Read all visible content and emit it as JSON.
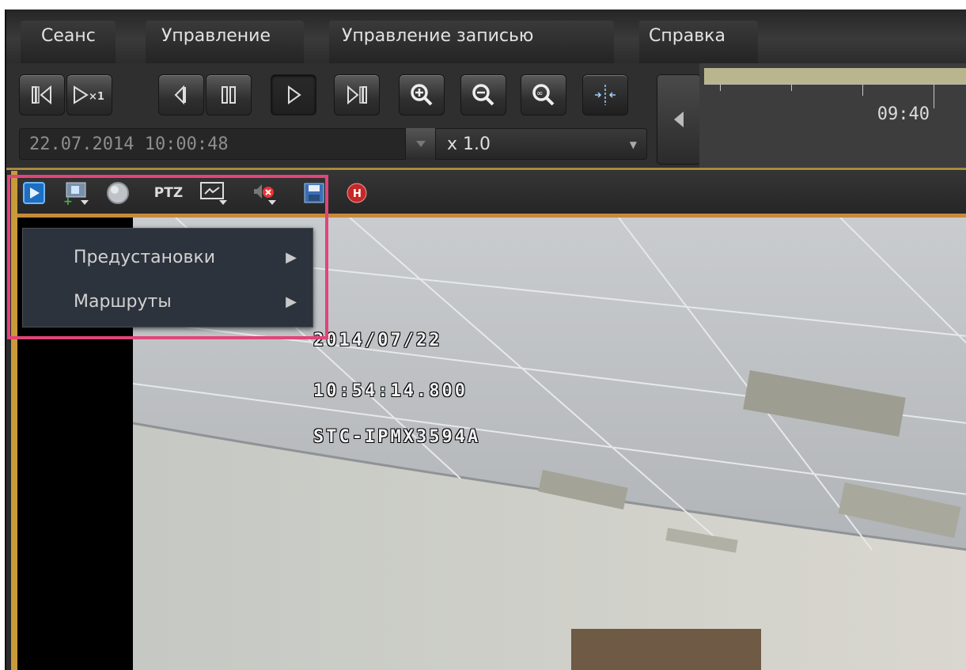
{
  "menu": {
    "items": [
      "Сеанс",
      "Управление",
      "Управление записью",
      "Справка"
    ]
  },
  "toolbar": {
    "buttons": [
      {
        "name": "go-start-button",
        "icon": "skip-to-start-icon"
      },
      {
        "name": "play-x1-button",
        "icon": "play-speed-x1-icon",
        "label": "×1"
      },
      {
        "name": "step-back-button",
        "icon": "step-back-icon"
      },
      {
        "name": "pause-button",
        "icon": "pause-icon"
      },
      {
        "name": "play-button",
        "icon": "play-icon"
      },
      {
        "name": "go-end-button",
        "icon": "skip-to-end-icon"
      },
      {
        "name": "zoom-in-button",
        "icon": "zoom-in-icon"
      },
      {
        "name": "zoom-out-button",
        "icon": "zoom-out-icon"
      },
      {
        "name": "zoom-fit-button",
        "icon": "zoom-fit-icon"
      },
      {
        "name": "split-button",
        "icon": "split-view-icon"
      }
    ],
    "datetime": "22.07.2014 10:00:48",
    "speed": "x 1.0"
  },
  "timeline": {
    "time_label": "09:40"
  },
  "panel": {
    "icons": [
      "play-icon",
      "add-camera-icon",
      "circle-icon",
      "ptz-icon",
      "display-icon",
      "mute-icon",
      "save-icon",
      "record-h-icon"
    ],
    "ptz_label": "PTZ",
    "record_label": "H"
  },
  "dropdown": {
    "items": [
      {
        "label": "Предустановки"
      },
      {
        "label": "Маршруты"
      }
    ]
  },
  "osd": {
    "date": "2014/07/22",
    "time": "10:54:14.800",
    "camera": "STC-IPMX3594A"
  },
  "colors": {
    "accent_highlight": "#e0457a",
    "timeline_bar": "#b9b58e",
    "panel_border": "#c88a3a"
  }
}
